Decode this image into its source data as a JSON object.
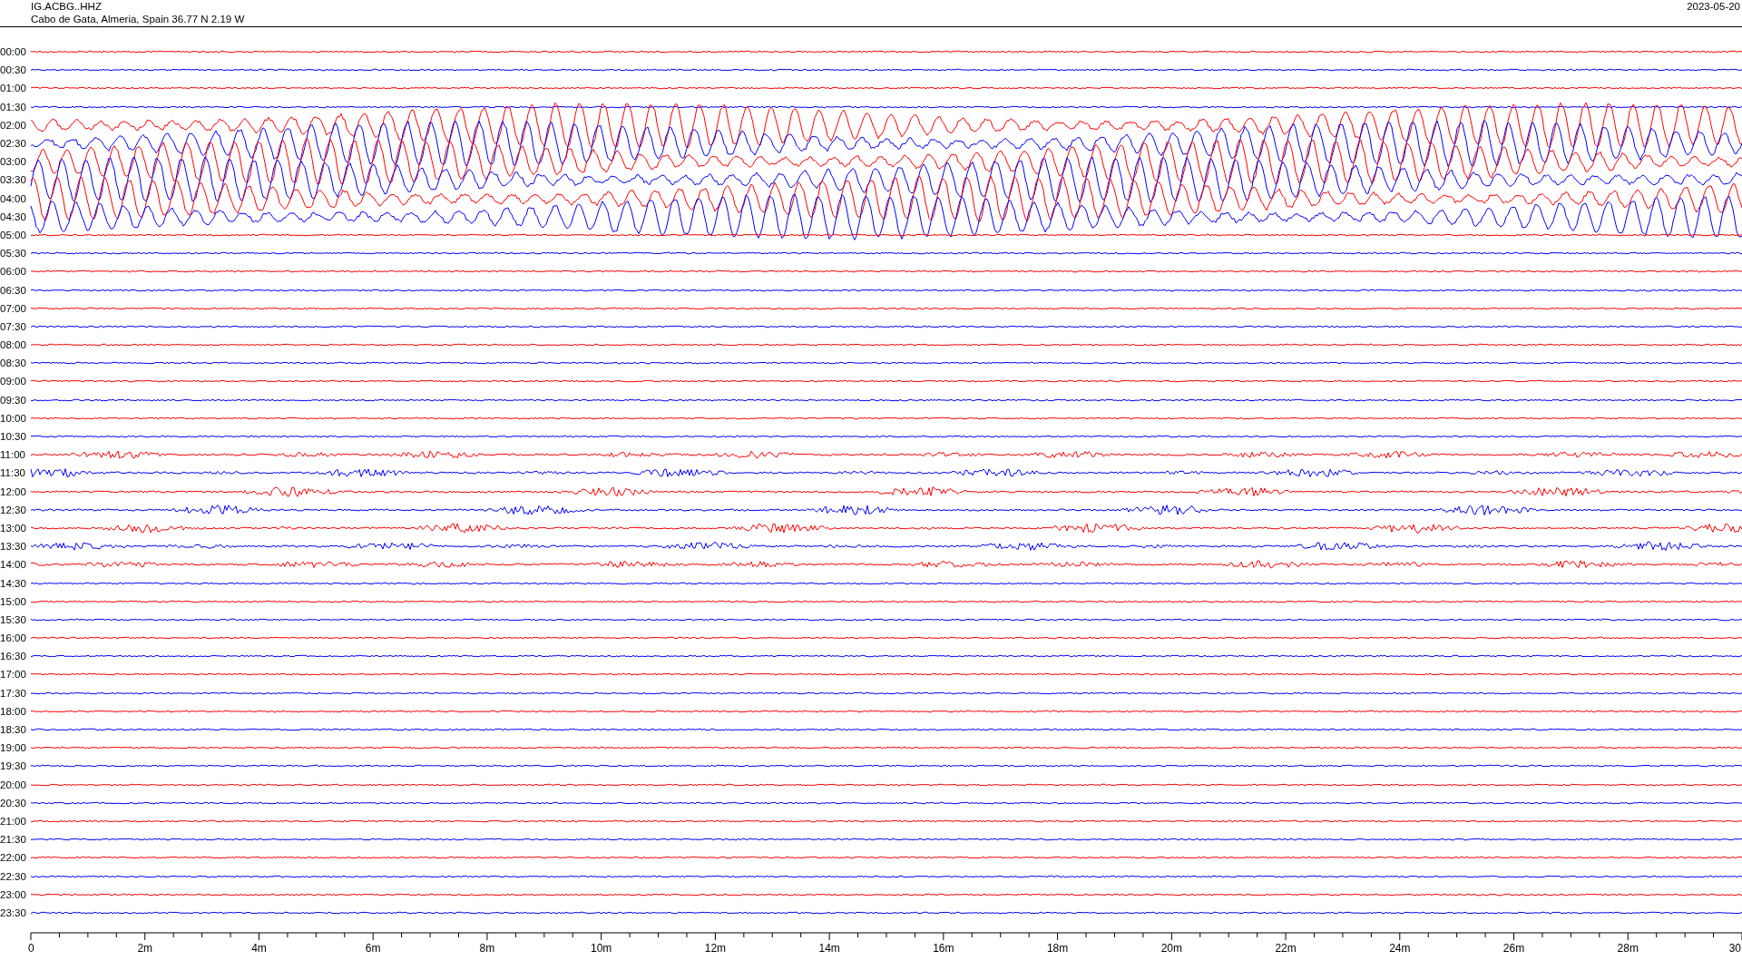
{
  "header": {
    "station": "IG.ACBG..HHZ",
    "location": "Cabo de Gata, Almeria, Spain  36.77 N 2.19 W",
    "date": "2023-05-20"
  },
  "rows": [
    {
      "time": "00:00",
      "color": "#ff0000",
      "kind": "quiet"
    },
    {
      "time": "00:30",
      "color": "#0000ff",
      "kind": "quiet"
    },
    {
      "time": "01:00",
      "color": "#ff0000",
      "kind": "quiet"
    },
    {
      "time": "01:30",
      "color": "#0000ff",
      "kind": "quiet"
    },
    {
      "time": "02:00",
      "color": "#ff0000",
      "kind": "swell"
    },
    {
      "time": "02:30",
      "color": "#0000ff",
      "kind": "swell"
    },
    {
      "time": "03:00",
      "color": "#ff0000",
      "kind": "swell"
    },
    {
      "time": "03:30",
      "color": "#0000ff",
      "kind": "swell"
    },
    {
      "time": "04:00",
      "color": "#ff0000",
      "kind": "swell"
    },
    {
      "time": "04:30",
      "color": "#0000ff",
      "kind": "swell"
    },
    {
      "time": "05:00",
      "color": "#ff0000",
      "kind": "quiet"
    },
    {
      "time": "05:30",
      "color": "#0000ff",
      "kind": "quiet"
    },
    {
      "time": "06:00",
      "color": "#ff0000",
      "kind": "quiet"
    },
    {
      "time": "06:30",
      "color": "#0000ff",
      "kind": "quiet"
    },
    {
      "time": "07:00",
      "color": "#ff0000",
      "kind": "quiet"
    },
    {
      "time": "07:30",
      "color": "#0000ff",
      "kind": "quiet"
    },
    {
      "time": "08:00",
      "color": "#ff0000",
      "kind": "quiet"
    },
    {
      "time": "08:30",
      "color": "#0000ff",
      "kind": "quiet"
    },
    {
      "time": "09:00",
      "color": "#ff0000",
      "kind": "quiet"
    },
    {
      "time": "09:30",
      "color": "#0000ff",
      "kind": "quiet"
    },
    {
      "time": "10:00",
      "color": "#ff0000",
      "kind": "quiet"
    },
    {
      "time": "10:30",
      "color": "#0000ff",
      "kind": "quiet"
    },
    {
      "time": "11:00",
      "color": "#ff0000",
      "kind": "noisy"
    },
    {
      "time": "11:30",
      "color": "#0000ff",
      "kind": "noisy"
    },
    {
      "time": "12:00",
      "color": "#ff0000",
      "kind": "noisy"
    },
    {
      "time": "12:30",
      "color": "#0000ff",
      "kind": "noisy"
    },
    {
      "time": "13:00",
      "color": "#ff0000",
      "kind": "noisy"
    },
    {
      "time": "13:30",
      "color": "#0000ff",
      "kind": "noisy"
    },
    {
      "time": "14:00",
      "color": "#ff0000",
      "kind": "noisy"
    },
    {
      "time": "14:30",
      "color": "#0000ff",
      "kind": "quiet"
    },
    {
      "time": "15:00",
      "color": "#ff0000",
      "kind": "quiet"
    },
    {
      "time": "15:30",
      "color": "#0000ff",
      "kind": "quiet"
    },
    {
      "time": "16:00",
      "color": "#ff0000",
      "kind": "quiet"
    },
    {
      "time": "16:30",
      "color": "#0000ff",
      "kind": "quiet"
    },
    {
      "time": "17:00",
      "color": "#ff0000",
      "kind": "quiet"
    },
    {
      "time": "17:30",
      "color": "#0000ff",
      "kind": "quiet"
    },
    {
      "time": "18:00",
      "color": "#ff0000",
      "kind": "quiet"
    },
    {
      "time": "18:30",
      "color": "#0000ff",
      "kind": "quiet"
    },
    {
      "time": "19:00",
      "color": "#ff0000",
      "kind": "quiet"
    },
    {
      "time": "19:30",
      "color": "#0000ff",
      "kind": "quiet"
    },
    {
      "time": "20:00",
      "color": "#ff0000",
      "kind": "quiet"
    },
    {
      "time": "20:30",
      "color": "#0000ff",
      "kind": "quiet"
    },
    {
      "time": "21:00",
      "color": "#ff0000",
      "kind": "quiet"
    },
    {
      "time": "21:30",
      "color": "#0000ff",
      "kind": "quiet"
    },
    {
      "time": "22:00",
      "color": "#ff0000",
      "kind": "quiet"
    },
    {
      "time": "22:30",
      "color": "#0000ff",
      "kind": "quiet"
    },
    {
      "time": "23:00",
      "color": "#ff0000",
      "kind": "quiet"
    },
    {
      "time": "23:30",
      "color": "#0000ff",
      "kind": "quiet"
    }
  ],
  "axis": {
    "labels": [
      "0",
      "2m",
      "4m",
      "6m",
      "8m",
      "10m",
      "12m",
      "14m",
      "16m",
      "18m",
      "20m",
      "22m",
      "24m",
      "26m",
      "28m",
      "30"
    ]
  }
}
